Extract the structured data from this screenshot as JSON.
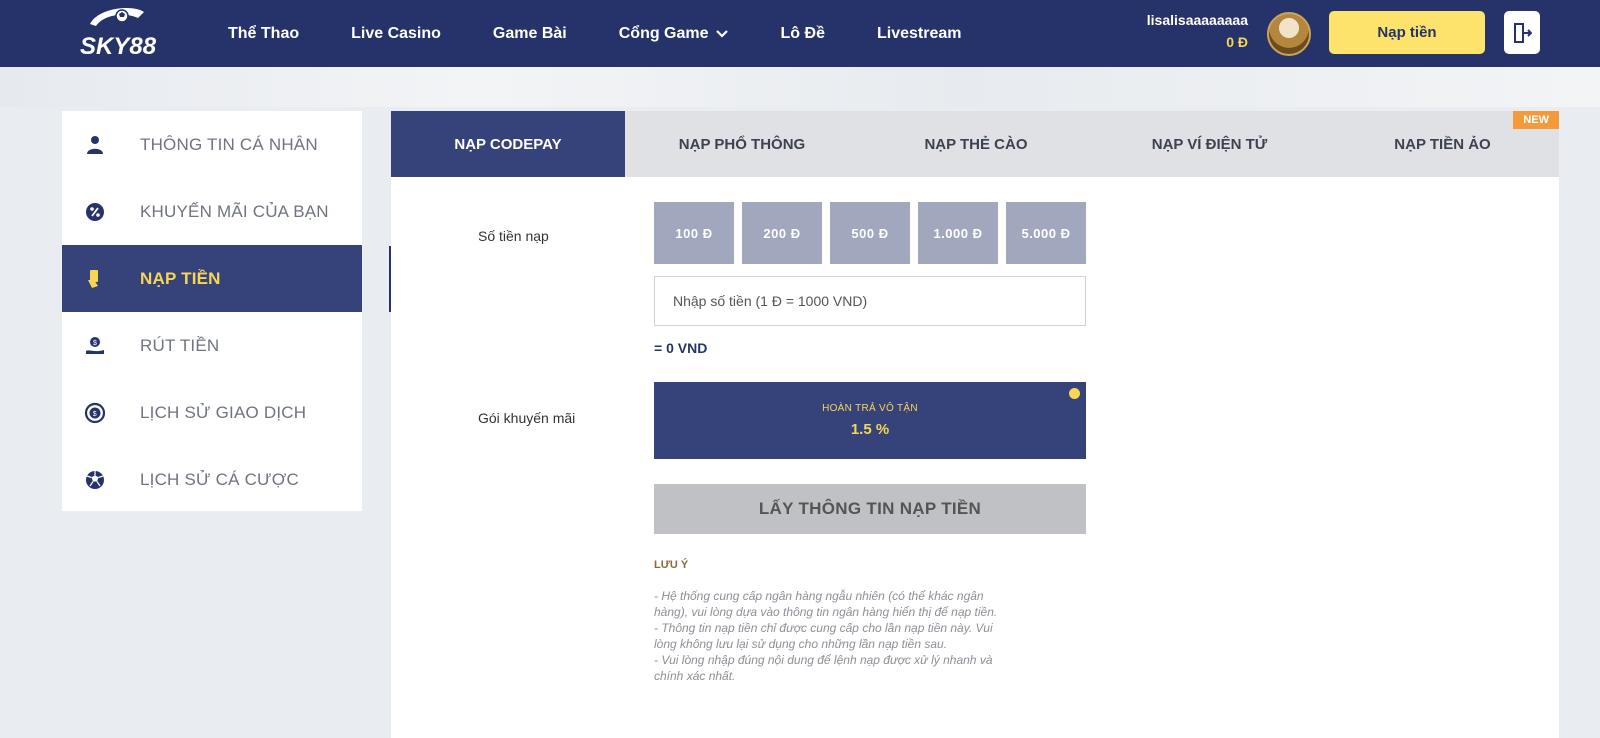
{
  "header": {
    "logo_text": "SKY88",
    "nav": [
      {
        "label": "Thể Thao"
      },
      {
        "label": "Live Casino"
      },
      {
        "label": "Game Bài"
      },
      {
        "label": "Cổng Game"
      },
      {
        "label": "Lô Đề"
      },
      {
        "label": "Livestream"
      }
    ],
    "username": "lisalisaaaaaaaa",
    "balance": "0 Đ",
    "deposit_label": "Nạp tiền",
    "icons": {
      "dropdown": "chevron-down-icon",
      "logout": "logout-icon"
    }
  },
  "sidebar": {
    "items": [
      {
        "label": "THÔNG TIN CÁ NHÂN",
        "icon": "user-icon",
        "active": false
      },
      {
        "label": "KHUYẾN MÃI CỦA BẠN",
        "icon": "percent-badge-icon",
        "active": false
      },
      {
        "label": "NẠP TIỀN",
        "icon": "card-hand-icon",
        "active": true
      },
      {
        "label": "RÚT TIỀN",
        "icon": "money-hand-icon",
        "active": false
      },
      {
        "label": "LỊCH SỬ GIAO DỊCH",
        "icon": "dollar-history-icon",
        "active": false
      },
      {
        "label": "LỊCH SỬ CÁ CƯỢC",
        "icon": "soccer-ball-icon",
        "active": false
      }
    ]
  },
  "tabs": [
    {
      "label": "NẠP CODEPAY",
      "active": true
    },
    {
      "label": "NẠP PHỔ THÔNG",
      "active": false
    },
    {
      "label": "NẠP THẺ CÀO",
      "active": false
    },
    {
      "label": "NẠP VÍ ĐIỆN TỬ",
      "active": false
    },
    {
      "label": "NẠP TIỀN ẢO",
      "active": false,
      "badge": "NEW"
    }
  ],
  "form": {
    "amount_label": "Số tiền nạp",
    "quick_amounts": [
      "100 Đ",
      "200 Đ",
      "500 Đ",
      "1.000 Đ",
      "5.000 Đ"
    ],
    "amount_placeholder": "Nhập số tiền (1 Đ = 1000 VND)",
    "amount_value": "",
    "converted": "= 0 VND",
    "promo_label": "Gói khuyến mãi",
    "promo": {
      "name": "HOÀN TRẢ VÔ TẬN",
      "rate": "1.5 %"
    },
    "submit_label": "LẤY THÔNG TIN NẠP TIỀN"
  },
  "notes": {
    "title": "LƯU Ý",
    "lines": [
      "- Hệ thống cung cấp ngân hàng ngẫu nhiên (có thể khác ngân hàng), vui lòng dựa vào thông tin ngân hàng hiển thị để nạp tiền.",
      "- Thông tin nạp tiền chỉ được cung cấp cho lần nạp tiền này. Vui lòng không lưu lại sử dụng cho những lần nạp tiền sau.",
      "- Vui lòng nhập đúng nội dung để lệnh nạp được xử lý nhanh và chính xác nhất."
    ]
  },
  "colors": {
    "navy": "#26336b",
    "active_navy": "#36437a",
    "yellow": "#f7d654",
    "button_yellow": "#fde36b",
    "badge_orange": "#f39a3b"
  }
}
